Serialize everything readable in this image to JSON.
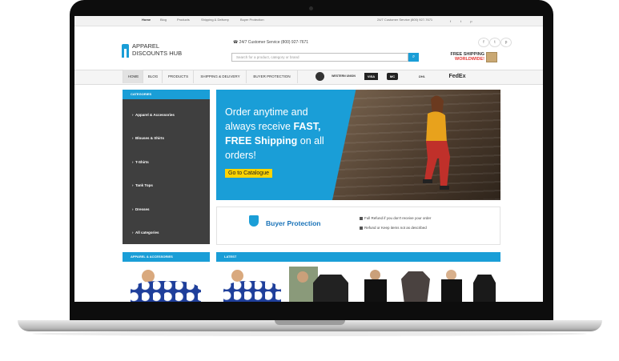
{
  "topbar": {
    "links": [
      "Home",
      "Blog",
      "Products",
      "Shipping & Delivery",
      "Buyer Protection"
    ],
    "service": "24/7 Customer Service (800) 927-7671",
    "social": [
      "f",
      "t",
      "p"
    ]
  },
  "logo": {
    "line1": "APPAREL",
    "line2": "DISCOUNTS HUB"
  },
  "header": {
    "service": "24/7 Customer Service (800) 927-7671",
    "search_placeholder": "Search for a product, category or brand",
    "shipping_line1": "FREE SHIPPING",
    "shipping_line2": "WORLDWIDE!",
    "social": [
      "f",
      "t",
      "p"
    ]
  },
  "nav": [
    "HOME",
    "BLOG",
    "PRODUCTS",
    "SHIPPING & DELIVERY",
    "BUYER PROTECTION"
  ],
  "payments": [
    "WESTERN UNION",
    "VISA",
    "MC",
    "DHL",
    "FedEx"
  ],
  "categories": {
    "title": "CATEGORIES",
    "items": [
      "Apparel & Accessories",
      "Blouses & Shirts",
      "T-Shirts",
      "Tank Tops",
      "Dresses",
      "All categories"
    ]
  },
  "banner": {
    "line1": "Order anytime and",
    "line2a": "always receive ",
    "line2b": "FAST,",
    "line3a": "FREE Shipping",
    "line3b": " on all",
    "line4": "orders!",
    "button": "Go to Catalogue"
  },
  "buyer_protection": {
    "title": "Buyer Protection",
    "check1": "Full Refund if you don't receive your order",
    "check2": "Refund or Keep items not as described"
  },
  "sections": {
    "apparel": "APPAREL & ACCESSORIES",
    "latest": "LATEST"
  },
  "colors": {
    "accent": "#1a9ed7",
    "button": "#ffd400",
    "sidebar": "#3f3f3f"
  }
}
